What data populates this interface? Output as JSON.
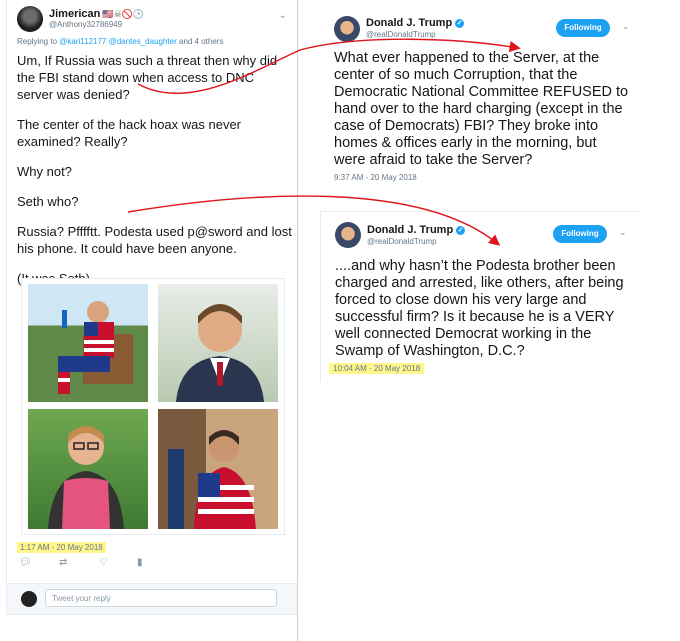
{
  "left_tweet": {
    "name": "Jimerican",
    "flags": "🇺🇸☠🚫🕒",
    "handle": "@Anthony32786949",
    "reply_prefix": "Replying to ",
    "reply_mentions": "@kari112177 @dantes_daughter",
    "reply_suffix": " and 4 others",
    "paragraphs": [
      "Um, If Russia was such a threat then why did the FBI stand down when access to DNC server was denied?",
      "The center of the hack hoax was never examined? Really?",
      "Why not?",
      "Seth who?",
      "Russia? Pfffftt. Podesta used p@sword and lost his phone. It could have been anyone.",
      "(It was Seth)"
    ],
    "timestamp": "1:17 AM - 20 May 2018",
    "reply_placeholder": "Tweet your reply"
  },
  "tweet1": {
    "name": "Donald J. Trump",
    "handle": "@realDonaldTrump",
    "follow_label": "Following",
    "text": "What ever happened to the Server, at the center of so much Corruption, that the Democratic National Committee REFUSED to hand over to the hard charging (except in the case of Democrats) FBI? They broke into homes & offices early in the morning, but were afraid to take the Server?",
    "timestamp": "9:37 AM - 20 May 2018"
  },
  "tweet2": {
    "name": "Donald J. Trump",
    "handle": "@realDonaldTrump",
    "follow_label": "Following",
    "text": "....and why hasn’t the Podesta brother been charged and arrested, like others, after being forced to close down his very large and successful firm? Is it because he is a VERY well connected Democrat working in the Swamp of Washington, D.C.?",
    "timestamp": "10:04 AM - 20 May 2018"
  },
  "colors": {
    "accent": "#1da1f2",
    "highlight": "#fff68c",
    "arrow": "#e0141b"
  }
}
